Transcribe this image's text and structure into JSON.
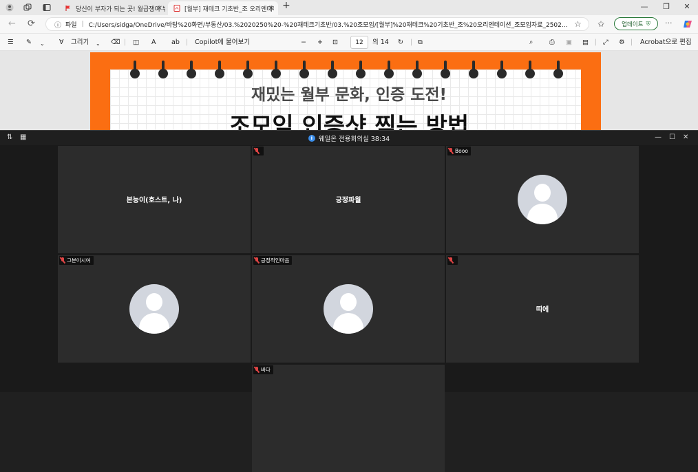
{
  "browser": {
    "tabs": [
      {
        "title": "당신이 부자가 되는 곳! 월급쟁이 부자들",
        "active": false
      },
      {
        "title": "[월부] 재테크 기초반_조 오리엔테이션",
        "active": true
      }
    ],
    "new_tab": "+",
    "address": {
      "scheme_label": "파일",
      "url": "C:/Users/sidga/OneDrive/바탕%20화면/부동산/03.%2020250%20-%20재테크기초반/03.%20조모임/[월부]%20재테크%20기초반_조%20오리엔테이션_조모임자료_2502..."
    },
    "update_label": "업데이트",
    "more_label": "···"
  },
  "pdf_toolbar": {
    "draw_label": "그리기",
    "copilot_label": "Copilot에 물어보기",
    "page_current": "12",
    "page_total": "의 14",
    "acrobat_label": "Acrobat으로 편집"
  },
  "pdf_page": {
    "subtitle": "재밌는 월부 문화, 인증 도전!",
    "title": "조모임 인증샷 찍는 방법",
    "accent_color": "#fb6e12"
  },
  "meeting": {
    "title": "웨일온 전용회의실 38:34",
    "participants": [
      {
        "name": "본능이(호스트, 나)",
        "tag": "",
        "muted": false,
        "has_avatar": false,
        "show_name_center": true
      },
      {
        "name": "긍정파월",
        "tag": "",
        "muted": true,
        "has_avatar": false,
        "show_name_center": true
      },
      {
        "name": "Booo",
        "tag": "Booo",
        "muted": true,
        "has_avatar": true,
        "show_name_center": false
      },
      {
        "name": "그분이시여",
        "tag": "그분이시여",
        "muted": true,
        "has_avatar": true,
        "show_name_center": false
      },
      {
        "name": "긍정적인마음",
        "tag": "긍정적인마음",
        "muted": true,
        "has_avatar": true,
        "show_name_center": false
      },
      {
        "name": "띠에",
        "tag": "",
        "muted": true,
        "has_avatar": false,
        "show_name_center": true
      },
      {
        "name": "바다",
        "tag": "바다",
        "muted": true,
        "has_avatar": false,
        "show_name_center": false
      }
    ]
  }
}
